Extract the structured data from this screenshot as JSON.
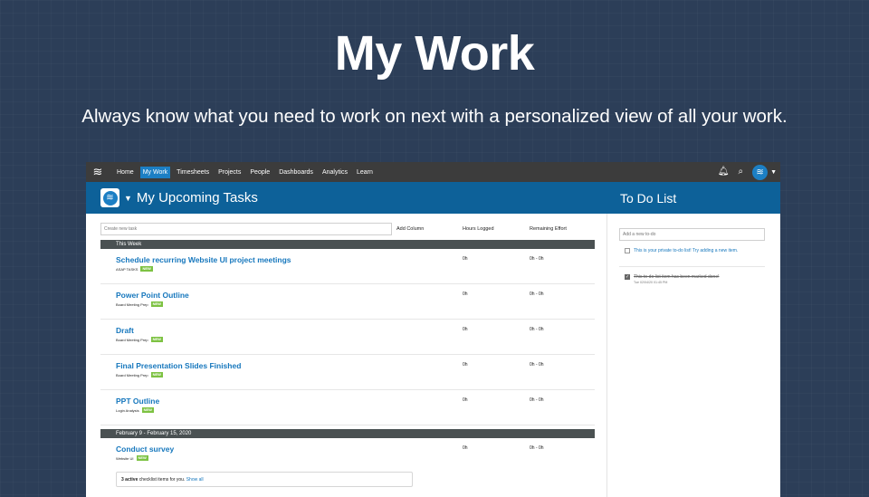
{
  "hero": {
    "title": "My Work",
    "subtitle": "Always know what you need to work on next with a personalized view of all your work."
  },
  "nav": {
    "logo_icon": "wavy-lines-logo",
    "items": [
      {
        "label": "Home",
        "active": false
      },
      {
        "label": "My Work",
        "active": true
      },
      {
        "label": "Timesheets",
        "active": false
      },
      {
        "label": "Projects",
        "active": false
      },
      {
        "label": "People",
        "active": false
      },
      {
        "label": "Dashboards",
        "active": false
      },
      {
        "label": "Analytics",
        "active": false
      },
      {
        "label": "Learn",
        "active": false
      }
    ],
    "right_icons": [
      "bell-icon",
      "search-icon",
      "avatar",
      "caret-down-icon"
    ]
  },
  "header": {
    "title": "My Upcoming Tasks",
    "todo_title": "To Do List"
  },
  "tasks": {
    "create_placeholder": "Create new task",
    "columns": {
      "add": "Add Column",
      "hours": "Hours Logged",
      "effort": "Remaining Effort"
    },
    "sections": [
      {
        "label": "This Week",
        "items": [
          {
            "title": "Schedule recurring Website UI project meetings",
            "project": "ASAP TASKS",
            "badge": "NEW",
            "hours": "0h",
            "effort": "0h - 0h"
          },
          {
            "title": "Power Point Outline",
            "project": "Board Meeting Prep",
            "badge": "NEW",
            "hours": "0h",
            "effort": "0h - 0h"
          },
          {
            "title": "Draft",
            "project": "Board Meeting Prep",
            "badge": "NEW",
            "hours": "0h",
            "effort": "0h - 0h"
          },
          {
            "title": "Final Presentation Slides Finished",
            "project": "Board Meeting Prep",
            "badge": "NEW",
            "hours": "0h",
            "effort": "0h - 0h"
          },
          {
            "title": "PPT Outline",
            "project": "Login Analysis",
            "badge": "NEW",
            "hours": "0h",
            "effort": "0h - 0h"
          }
        ]
      },
      {
        "label": "February 9 - February 15, 2020",
        "items": [
          {
            "title": "Conduct survey",
            "project": "Website UI",
            "badge": "NEW",
            "hours": "0h",
            "effort": "0h - 0h"
          }
        ]
      }
    ],
    "checklist": {
      "count": "3 active",
      "text": " checklist items for you. ",
      "link": "Show all"
    }
  },
  "todo": {
    "placeholder": "Add a new to-do",
    "items": [
      {
        "text": "This is your private to-do list! Try adding a new item.",
        "done": false,
        "date": ""
      },
      {
        "text": "This to-do list item has been marked done!",
        "done": true,
        "date": "Tue 02/04/20 01:45 PM"
      }
    ]
  }
}
